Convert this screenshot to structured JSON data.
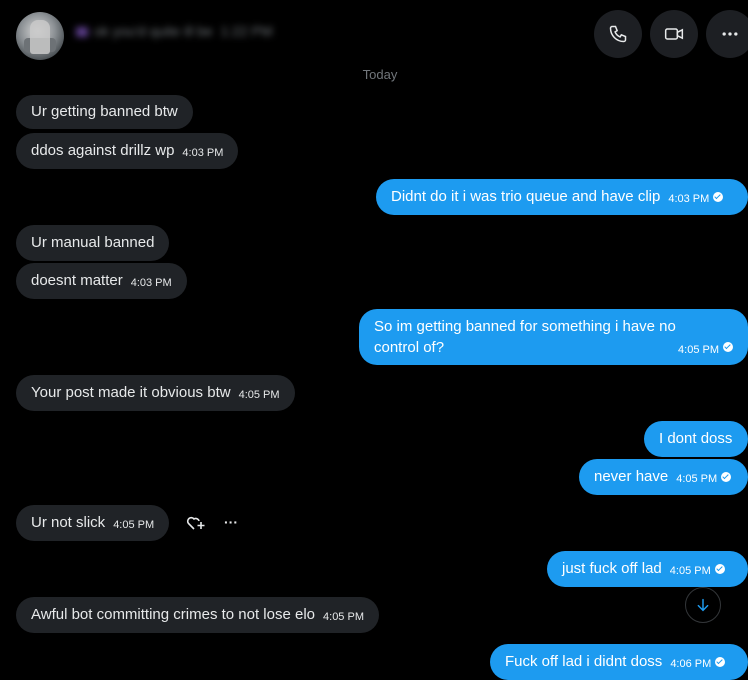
{
  "header": {
    "contact_name": "ok you'd quite ill be",
    "contact_time": "1:22 PM",
    "buttons": [
      "phone-icon",
      "video-icon",
      "more-icon"
    ]
  },
  "date_divider": "Today",
  "messages": [
    {
      "side": "in",
      "text": "Ur getting banned btw",
      "time": ""
    },
    {
      "side": "in",
      "text": "ddos against drillz wp",
      "time": "4:03 PM"
    },
    {
      "side": "out",
      "text": "Didnt do it i was trio queue and have clip",
      "time": "4:03 PM"
    },
    {
      "side": "in",
      "text": "Ur manual banned",
      "time": ""
    },
    {
      "side": "in",
      "text": "doesnt matter",
      "time": "4:03 PM"
    },
    {
      "side": "out",
      "line1": "So im getting banned for something i have no",
      "line2": "control of?",
      "time": "4:05 PM"
    },
    {
      "side": "in",
      "text": "Your post made it obvious btw",
      "time": "4:05 PM"
    },
    {
      "side": "out",
      "text": "I dont doss",
      "time": ""
    },
    {
      "side": "out",
      "text": "never have",
      "time": "4:05 PM"
    },
    {
      "side": "in",
      "text": "Ur not slick",
      "time": "4:05 PM"
    },
    {
      "side": "out",
      "text": "just fuck off lad",
      "time": "4:05 PM"
    },
    {
      "side": "in",
      "text": "Awful bot committing crimes to not lose elo",
      "time": "4:05 PM"
    },
    {
      "side": "out",
      "text": "Fuck off lad i didnt doss",
      "time": "4:06 PM"
    }
  ],
  "colors": {
    "background": "#000000",
    "incoming": "#202327",
    "outgoing": "#1d9bf0",
    "muted": "#71767b"
  }
}
